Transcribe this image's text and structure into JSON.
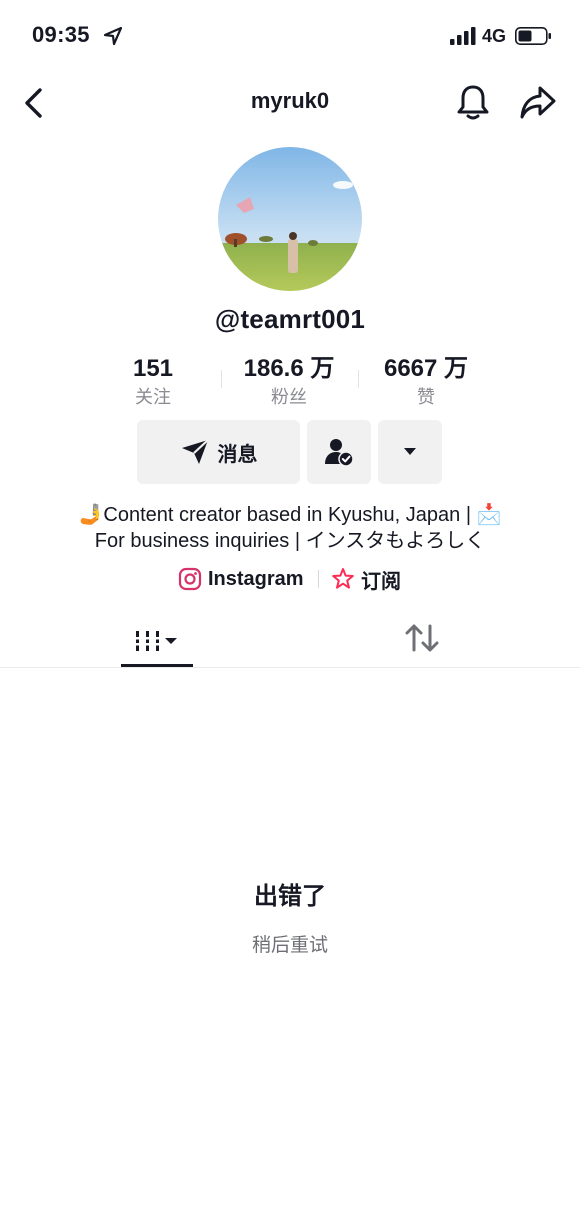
{
  "status_bar": {
    "time": "09:35",
    "network": "4G"
  },
  "header": {
    "username": "myruk0"
  },
  "profile": {
    "handle": "@teamrt001",
    "stats": [
      {
        "value": "151",
        "label": "关注"
      },
      {
        "value": "186.6 万",
        "label": "粉丝"
      },
      {
        "value": "6667 万",
        "label": "赞"
      }
    ]
  },
  "actions": {
    "message_label": "消息"
  },
  "bio": {
    "line1": "🤳Content creator based in Kyushu, Japan | 📩",
    "line2": "For business inquiries | インスタもよろしく"
  },
  "links": {
    "instagram_label": "Instagram",
    "subscribe_label": "订阅"
  },
  "error": {
    "title": "出错了",
    "subtitle": "稍后重试"
  },
  "colors": {
    "text": "#161823",
    "muted": "#8a8b91",
    "button_bg": "#f1f1f2",
    "brand_pink": "#fe2c55"
  }
}
